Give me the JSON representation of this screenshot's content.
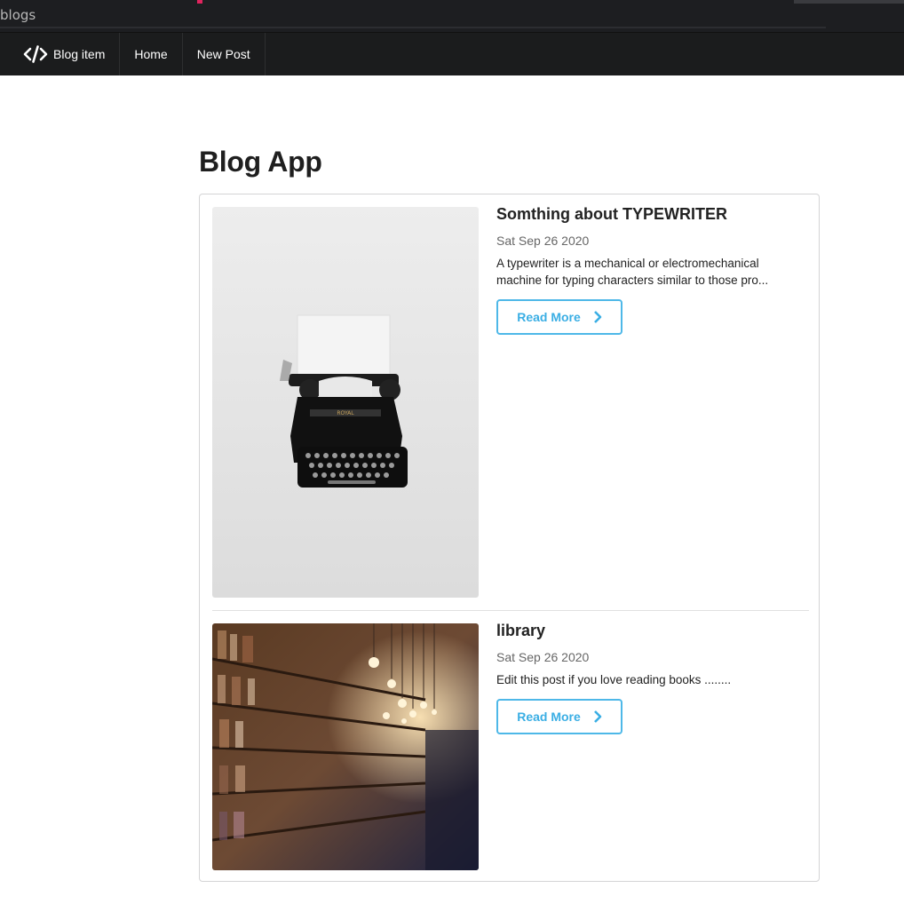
{
  "browser": {
    "address_fragment": "blogs"
  },
  "nav": {
    "brand_icon": "code-icon",
    "brand_label": "Blog item",
    "items": [
      {
        "label": "Home"
      },
      {
        "label": "New Post"
      }
    ]
  },
  "page": {
    "title": "Blog App"
  },
  "posts": [
    {
      "title": "Somthing about TYPEWRITER",
      "date": "Sat Sep 26 2020",
      "excerpt": "A typewriter is a mechanical or electromechanical machine for typing characters similar to those pro...",
      "button_label": "Read More",
      "button_icon": "chevron-right-icon",
      "image_subject": "typewriter"
    },
    {
      "title": "library",
      "date": "Sat Sep 26 2020",
      "excerpt": "Edit this post if you love reading books ........",
      "button_label": "Read More",
      "button_icon": "chevron-right-icon",
      "image_subject": "library"
    }
  ],
  "colors": {
    "nav_bg": "#1b1c1d",
    "accent": "#4eb8e8",
    "card_border": "#d4d4d5"
  }
}
